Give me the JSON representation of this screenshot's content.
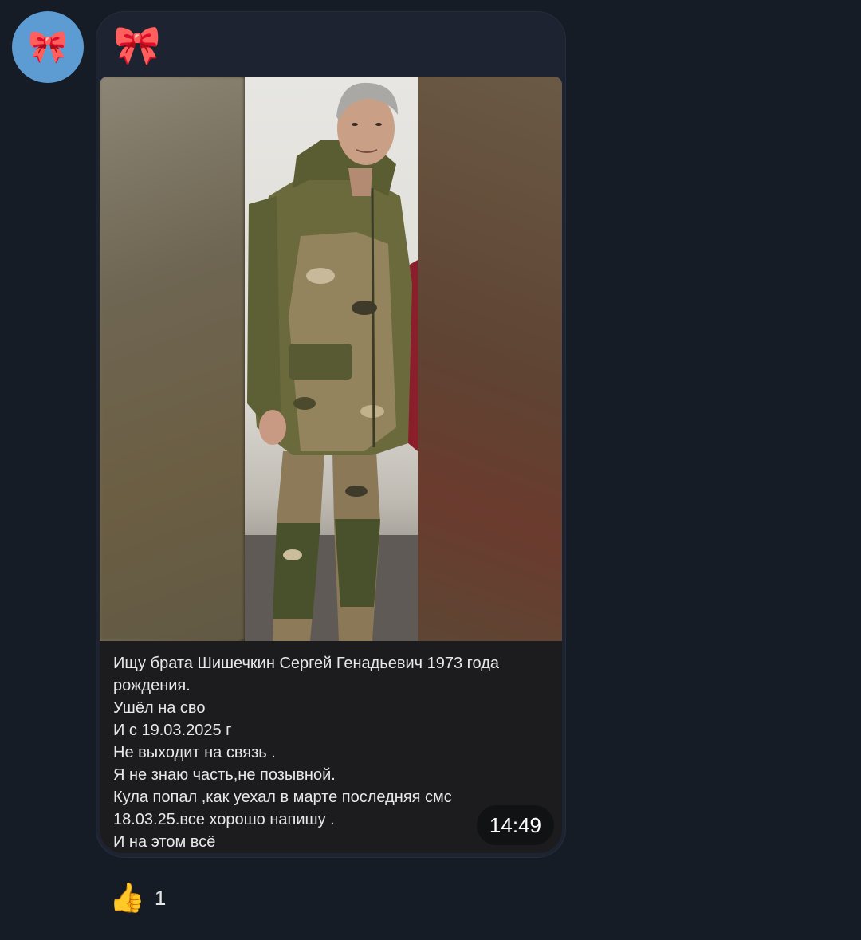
{
  "avatar": {
    "emoji": "🎀"
  },
  "message": {
    "sender": "🎀",
    "caption": "Ищу брата Шишечкин Сергей Генадьевич 1973 года рождения.\nУшёл на сво\nИ с 19.03.2025 г\nНе выходит на связь .\nЯ не знаю часть,не позывной.\nКула попал ,как уехал в марте последняя смс 18.03.25.все хорошо напишу .\nИ на этом всё",
    "time": "14:49"
  },
  "reaction": {
    "emoji": "👍",
    "count": "1"
  }
}
